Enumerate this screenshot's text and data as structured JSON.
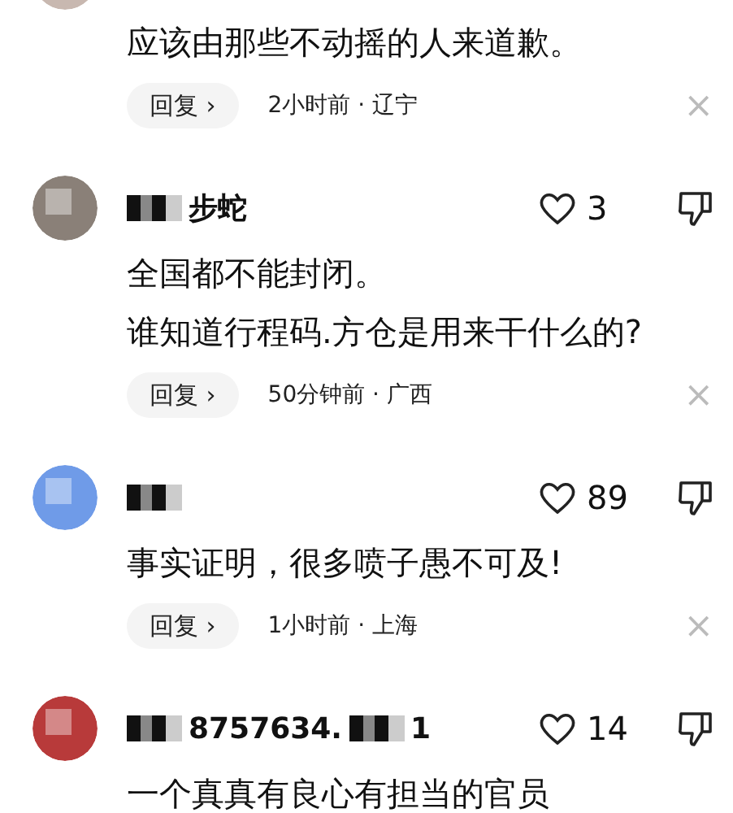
{
  "comments": [
    {
      "lines": [
        "应该由那些不动摇的人来道歉。"
      ],
      "reply": "回复",
      "reply_caret": "›",
      "meta": "2小时前 · 辽宁",
      "close": "×"
    },
    {
      "name_segments": [
        {
          "kind": "redacted"
        },
        {
          "kind": "text",
          "text": "步蛇"
        }
      ],
      "likes": "3",
      "lines": [
        "全国都不能封闭。",
        "谁知道行程码.方仓是用来干什么的?"
      ],
      "reply": "回复",
      "reply_caret": "›",
      "meta": "50分钟前 · 广西",
      "close": "×"
    },
    {
      "name_segments": [
        {
          "kind": "redacted"
        }
      ],
      "likes": "89",
      "lines": [
        "事实证明，很多喷子愚不可及!"
      ],
      "reply": "回复",
      "reply_caret": "›",
      "meta": "1小时前 · 上海",
      "close": "×"
    },
    {
      "name_segments": [
        {
          "kind": "redacted"
        },
        {
          "kind": "text",
          "text": "8757634."
        },
        {
          "kind": "redacted"
        },
        {
          "kind": "text",
          "text": "1"
        }
      ],
      "likes": "14",
      "lines": [
        "一个真真有良心有担当的官员"
      ]
    }
  ]
}
